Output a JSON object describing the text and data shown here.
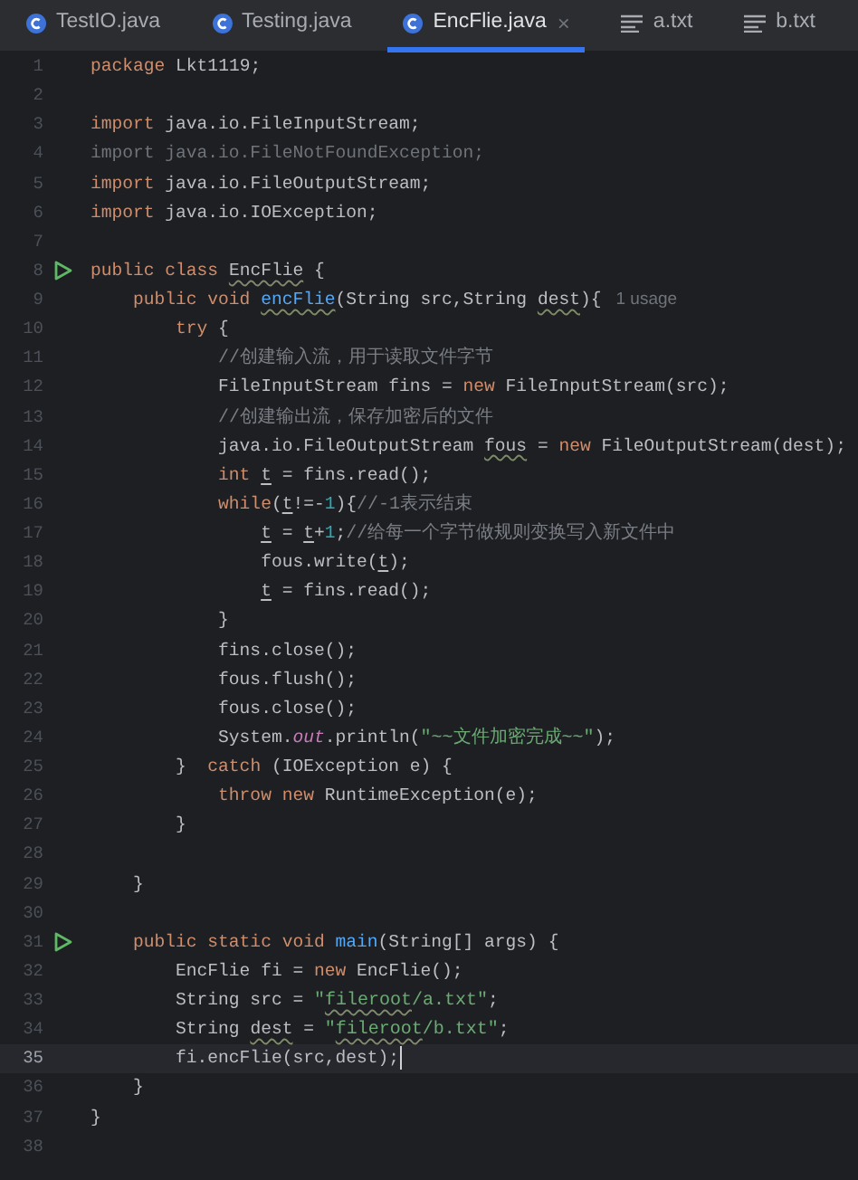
{
  "tabs": [
    {
      "label": "TestIO.java",
      "kind": "java",
      "selected": false
    },
    {
      "label": "Testing.java",
      "kind": "java",
      "selected": false
    },
    {
      "label": "EncFlie.java",
      "kind": "java",
      "selected": true,
      "close": "×"
    },
    {
      "label": "a.txt",
      "kind": "text",
      "selected": false
    },
    {
      "label": "b.txt",
      "kind": "text",
      "selected": false
    }
  ],
  "lines": [
    {
      "number": "1",
      "tokens": [
        {
          "kind": "k",
          "text": "package "
        },
        {
          "kind": "p",
          "text": "Lkt1119;"
        }
      ]
    },
    {
      "number": "2"
    },
    {
      "number": "3",
      "tokens": [
        {
          "kind": "k",
          "text": "import "
        },
        {
          "kind": "p",
          "text": "java.io.FileInputStream;"
        }
      ]
    },
    {
      "number": "4",
      "tokens": [
        {
          "kind": "u",
          "text": "import java.io.FileNotFoundException;"
        }
      ]
    },
    {
      "number": "5",
      "tokens": [
        {
          "kind": "k",
          "text": "import "
        },
        {
          "kind": "p",
          "text": "java.io.FileOutputStream;"
        }
      ]
    },
    {
      "number": "6",
      "tokens": [
        {
          "kind": "k",
          "text": "import "
        },
        {
          "kind": "p",
          "text": "java.io.IOException;"
        }
      ]
    },
    {
      "number": "7"
    },
    {
      "number": "8",
      "run": true,
      "tokens": [
        {
          "kind": "k",
          "text": "public class "
        },
        {
          "kind": "p",
          "text": "EncFlie",
          "typo": true
        },
        {
          "kind": "p",
          "text": " {"
        }
      ],
      "children": [
        {
          "number": "9",
          "tokens": [
            {
              "kind": "k",
              "text": "public void "
            },
            {
              "kind": "d",
              "text": "encFlie",
              "typo": true
            },
            {
              "kind": "p",
              "text": "(String src,String "
            },
            {
              "kind": "p",
              "text": "dest",
              "typo": true
            },
            {
              "kind": "p",
              "text": "){"
            },
            {
              "kind": "h",
              "text": "1 usage"
            }
          ],
          "children": [
            {
              "number": "10",
              "tokens": [
                {
                  "kind": "k",
                  "text": "try"
                },
                {
                  "kind": "p",
                  "text": " {"
                }
              ],
              "children": [
                {
                  "number": "11",
                  "tokens": [
                    {
                      "kind": "c",
                      "text": "//创建输入流，用于读取文件字节"
                    }
                  ]
                },
                {
                  "number": "12",
                  "tokens": [
                    {
                      "kind": "p",
                      "text": "FileInputStream fins = "
                    },
                    {
                      "kind": "k",
                      "text": "new"
                    },
                    {
                      "kind": "p",
                      "text": " FileInputStream(src);"
                    }
                  ]
                },
                {
                  "number": "13",
                  "tokens": [
                    {
                      "kind": "c",
                      "text": "//创建输出流，保存加密后的文件"
                    }
                  ]
                },
                {
                  "number": "14",
                  "tokens": [
                    {
                      "kind": "p",
                      "text": "java.io.FileOutputStream "
                    },
                    {
                      "kind": "p",
                      "text": "fous",
                      "typo": true
                    },
                    {
                      "kind": "p",
                      "text": " = "
                    },
                    {
                      "kind": "k",
                      "text": "new"
                    },
                    {
                      "kind": "p",
                      "text": " FileOutputStream(dest);"
                    }
                  ]
                },
                {
                  "number": "15",
                  "tokens": [
                    {
                      "kind": "k",
                      "text": "int "
                    },
                    {
                      "kind": "p",
                      "text": "t",
                      "reassigned": true
                    },
                    {
                      "kind": "p",
                      "text": " = fins.read();"
                    }
                  ]
                },
                {
                  "number": "16",
                  "tokens": [
                    {
                      "kind": "k",
                      "text": "while"
                    },
                    {
                      "kind": "p",
                      "text": "("
                    },
                    {
                      "kind": "p",
                      "text": "t",
                      "reassigned": true
                    },
                    {
                      "kind": "p",
                      "text": "!=-"
                    },
                    {
                      "kind": "n",
                      "text": "1"
                    },
                    {
                      "kind": "p",
                      "text": "){"
                    },
                    {
                      "kind": "c",
                      "text": "//-1表示结束"
                    }
                  ],
                  "children": [
                    {
                      "number": "17",
                      "tokens": [
                        {
                          "kind": "p",
                          "text": "t",
                          "reassigned": true
                        },
                        {
                          "kind": "p",
                          "text": " = "
                        },
                        {
                          "kind": "p",
                          "text": "t",
                          "reassigned": true
                        },
                        {
                          "kind": "p",
                          "text": "+"
                        },
                        {
                          "kind": "n",
                          "text": "1"
                        },
                        {
                          "kind": "p",
                          "text": ";"
                        },
                        {
                          "kind": "c",
                          "text": "//给每一个字节做规则变换写入新文件中"
                        }
                      ]
                    },
                    {
                      "number": "18",
                      "tokens": [
                        {
                          "kind": "p",
                          "text": "fous.write("
                        },
                        {
                          "kind": "p",
                          "text": "t",
                          "reassigned": true
                        },
                        {
                          "kind": "p",
                          "text": ");"
                        }
                      ]
                    },
                    {
                      "number": "19",
                      "tokens": [
                        {
                          "kind": "p",
                          "text": "t",
                          "reassigned": true
                        },
                        {
                          "kind": "p",
                          "text": " = fins.read();"
                        }
                      ]
                    }
                  ]
                },
                {
                  "number": "20",
                  "tokens": [
                    {
                      "kind": "p",
                      "text": "}"
                    }
                  ]
                },
                {
                  "number": "21",
                  "tokens": [
                    {
                      "kind": "p",
                      "text": "fins.close();"
                    }
                  ]
                },
                {
                  "number": "22",
                  "tokens": [
                    {
                      "kind": "p",
                      "text": "fous.flush();"
                    }
                  ]
                },
                {
                  "number": "23",
                  "tokens": [
                    {
                      "kind": "p",
                      "text": "fous.close();"
                    }
                  ]
                },
                {
                  "number": "24",
                  "tokens": [
                    {
                      "kind": "p",
                      "text": "System."
                    },
                    {
                      "kind": "f",
                      "text": "out"
                    },
                    {
                      "kind": "p",
                      "text": ".println("
                    },
                    {
                      "kind": "s",
                      "text": "\"~~文件加密完成~~\""
                    },
                    {
                      "kind": "p",
                      "text": ");"
                    }
                  ]
                }
              ]
            },
            {
              "number": "25",
              "tokens": [
                {
                  "kind": "p",
                  "text": "}  "
                },
                {
                  "kind": "k",
                  "text": "catch"
                },
                {
                  "kind": "p",
                  "text": " (IOException e) {"
                }
              ],
              "children": [
                {
                  "number": "26",
                  "tokens": [
                    {
                      "kind": "k",
                      "text": "throw new"
                    },
                    {
                      "kind": "p",
                      "text": " RuntimeException(e);"
                    }
                  ]
                }
              ]
            },
            {
              "number": "27",
              "tokens": [
                {
                  "kind": "p",
                  "text": "}"
                }
              ]
            },
            {
              "number": "28"
            }
          ]
        },
        {
          "number": "29",
          "tokens": [
            {
              "kind": "p",
              "text": "}"
            }
          ]
        },
        {
          "number": "30"
        },
        {
          "number": "31",
          "run": true,
          "tokens": [
            {
              "kind": "k",
              "text": "public static void "
            },
            {
              "kind": "d",
              "text": "main"
            },
            {
              "kind": "p",
              "text": "(String[] args) {"
            }
          ],
          "children": [
            {
              "number": "32",
              "tokens": [
                {
                  "kind": "p",
                  "text": "EncFlie fi = "
                },
                {
                  "kind": "k",
                  "text": "new"
                },
                {
                  "kind": "p",
                  "text": " EncFlie();"
                }
              ]
            },
            {
              "number": "33",
              "tokens": [
                {
                  "kind": "p",
                  "text": "String src = "
                },
                {
                  "kind": "s",
                  "text": "\""
                },
                {
                  "kind": "s",
                  "text": "fileroot",
                  "typo": true
                },
                {
                  "kind": "s",
                  "text": "/a.txt\""
                },
                {
                  "kind": "p",
                  "text": ";"
                }
              ]
            },
            {
              "number": "34",
              "tokens": [
                {
                  "kind": "p",
                  "text": "String "
                },
                {
                  "kind": "p",
                  "text": "dest",
                  "typo": true
                },
                {
                  "kind": "p",
                  "text": " = "
                },
                {
                  "kind": "s",
                  "text": "\""
                },
                {
                  "kind": "s",
                  "text": "fileroot",
                  "typo": true
                },
                {
                  "kind": "s",
                  "text": "/b.txt\""
                },
                {
                  "kind": "p",
                  "text": ";"
                }
              ]
            },
            {
              "number": "35",
              "current": true,
              "tokens": [
                {
                  "kind": "p",
                  "text": "fi.encFlie(src,dest);"
                }
              ]
            }
          ]
        },
        {
          "number": "36",
          "tokens": [
            {
              "kind": "p",
              "text": "}"
            }
          ]
        }
      ]
    },
    {
      "number": "37",
      "tokens": [
        {
          "kind": "p",
          "text": "}"
        }
      ]
    },
    {
      "number": "38"
    }
  ]
}
